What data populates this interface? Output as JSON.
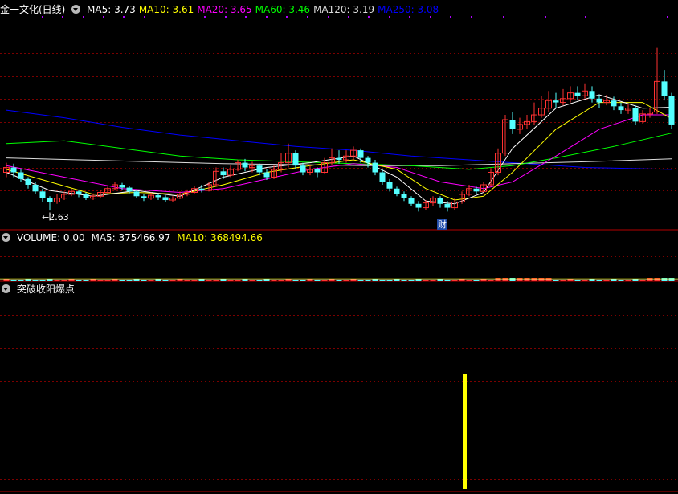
{
  "main_panel": {
    "title": "金一文化(日线)",
    "indicators": [
      {
        "label": "MA5: 3.73",
        "color": "#ffffff"
      },
      {
        "label": "MA10: 3.61",
        "color": "#ffff00"
      },
      {
        "label": "MA20: 3.65",
        "color": "#ff00ff"
      },
      {
        "label": "MA60: 3.46",
        "color": "#00ff00"
      },
      {
        "label": "MA120: 3.19",
        "color": "#dcdcdc"
      },
      {
        "label": "MA250: 3.08",
        "color": "#0000ff"
      }
    ],
    "low_label": "←2.63",
    "event_marker": "财"
  },
  "volume_panel": {
    "title": "VOLUME: 0.00",
    "ma5": "MA5: 375466.97",
    "ma10": "MA10: 368494.66"
  },
  "signal_panel": {
    "title": "突破收阳爆点"
  },
  "colors": {
    "up": "#ff3232",
    "down": "#54ffff",
    "grid": "#7a0000",
    "ma5": "#ffffff",
    "ma10": "#ffff00",
    "ma20": "#ff00ff",
    "ma60": "#00ff00",
    "ma120": "#dcdcdc",
    "ma250": "#0000ff",
    "signal": "#ffff00"
  },
  "chart_data": {
    "type": "candlestick",
    "symbol": "金一文化",
    "period": "日线",
    "ylim": [
      2.5,
      4.7
    ],
    "low_marker": 2.63,
    "ma_last": {
      "MA5": 3.73,
      "MA10": 3.61,
      "MA20": 3.65,
      "MA60": 3.46,
      "MA120": 3.19,
      "MA250": 3.08
    },
    "candles": [
      [
        3.05,
        3.1,
        3.15,
        3.0
      ],
      [
        3.1,
        3.05,
        3.14,
        3.0
      ],
      [
        3.05,
        2.98,
        3.08,
        2.95
      ],
      [
        2.98,
        2.92,
        3.0,
        2.88
      ],
      [
        2.92,
        2.85,
        2.95,
        2.82
      ],
      [
        2.85,
        2.78,
        2.88,
        2.74
      ],
      [
        2.78,
        2.74,
        2.8,
        2.65
      ],
      [
        2.74,
        2.78,
        2.82,
        2.72
      ],
      [
        2.78,
        2.82,
        2.85,
        2.76
      ],
      [
        2.82,
        2.85,
        2.88,
        2.8
      ],
      [
        2.85,
        2.82,
        2.87,
        2.79
      ],
      [
        2.82,
        2.78,
        2.84,
        2.76
      ],
      [
        2.78,
        2.8,
        2.83,
        2.76
      ],
      [
        2.8,
        2.84,
        2.86,
        2.78
      ],
      [
        2.84,
        2.88,
        2.9,
        2.82
      ],
      [
        2.88,
        2.92,
        2.95,
        2.86
      ],
      [
        2.92,
        2.89,
        2.94,
        2.86
      ],
      [
        2.89,
        2.85,
        2.91,
        2.83
      ],
      [
        2.85,
        2.8,
        2.87,
        2.78
      ],
      [
        2.8,
        2.78,
        2.82,
        2.75
      ],
      [
        2.78,
        2.81,
        2.84,
        2.76
      ],
      [
        2.81,
        2.79,
        2.83,
        2.76
      ],
      [
        2.79,
        2.76,
        2.81,
        2.74
      ],
      [
        2.76,
        2.78,
        2.8,
        2.74
      ],
      [
        2.78,
        2.82,
        2.85,
        2.77
      ],
      [
        2.82,
        2.84,
        2.87,
        2.8
      ],
      [
        2.84,
        2.88,
        2.91,
        2.83
      ],
      [
        2.88,
        2.86,
        2.92,
        2.84
      ],
      [
        2.86,
        2.92,
        2.95,
        2.85
      ],
      [
        2.92,
        3.06,
        3.1,
        2.9
      ],
      [
        3.06,
        3.02,
        3.1,
        2.98
      ],
      [
        3.02,
        3.08,
        3.12,
        3.0
      ],
      [
        3.08,
        3.15,
        3.18,
        3.06
      ],
      [
        3.15,
        3.1,
        3.19,
        3.06
      ],
      [
        3.1,
        3.12,
        3.16,
        3.05
      ],
      [
        3.12,
        3.05,
        3.14,
        3.02
      ],
      [
        3.05,
        3.0,
        3.08,
        2.97
      ],
      [
        3.0,
        3.08,
        3.12,
        2.98
      ],
      [
        3.08,
        3.15,
        3.25,
        3.05
      ],
      [
        3.15,
        3.25,
        3.35,
        3.1
      ],
      [
        3.25,
        3.12,
        3.28,
        3.08
      ],
      [
        3.12,
        3.05,
        3.15,
        3.02
      ],
      [
        3.05,
        3.08,
        3.12,
        3.02
      ],
      [
        3.08,
        3.05,
        3.1,
        3.0
      ],
      [
        3.05,
        3.15,
        3.2,
        3.04
      ],
      [
        3.15,
        3.2,
        3.3,
        3.12
      ],
      [
        3.2,
        3.18,
        3.28,
        3.14
      ],
      [
        3.18,
        3.22,
        3.28,
        3.15
      ],
      [
        3.22,
        3.28,
        3.32,
        3.18
      ],
      [
        3.28,
        3.2,
        3.3,
        3.15
      ],
      [
        3.2,
        3.15,
        3.22,
        3.1
      ],
      [
        3.15,
        3.05,
        3.18,
        3.02
      ],
      [
        3.05,
        2.95,
        3.08,
        2.92
      ],
      [
        2.95,
        2.88,
        2.98,
        2.85
      ],
      [
        2.88,
        2.82,
        2.9,
        2.8
      ],
      [
        2.82,
        2.78,
        2.85,
        2.75
      ],
      [
        2.78,
        2.72,
        2.8,
        2.7
      ],
      [
        2.72,
        2.68,
        2.75,
        2.64
      ],
      [
        2.68,
        2.73,
        2.76,
        2.66
      ],
      [
        2.73,
        2.78,
        2.8,
        2.7
      ],
      [
        2.78,
        2.72,
        2.8,
        2.68
      ],
      [
        2.72,
        2.68,
        2.75,
        2.64
      ],
      [
        2.68,
        2.74,
        2.78,
        2.66
      ],
      [
        2.74,
        2.82,
        2.85,
        2.72
      ],
      [
        2.82,
        2.88,
        2.92,
        2.8
      ],
      [
        2.88,
        2.85,
        2.9,
        2.82
      ],
      [
        2.85,
        2.92,
        2.95,
        2.84
      ],
      [
        2.92,
        3.05,
        3.08,
        2.9
      ],
      [
        3.05,
        3.25,
        3.3,
        3.02
      ],
      [
        3.25,
        3.6,
        3.65,
        3.22
      ],
      [
        3.6,
        3.5,
        3.68,
        3.45
      ],
      [
        3.5,
        3.55,
        3.62,
        3.45
      ],
      [
        3.55,
        3.58,
        3.65,
        3.5
      ],
      [
        3.58,
        3.65,
        3.78,
        3.55
      ],
      [
        3.65,
        3.72,
        3.85,
        3.62
      ],
      [
        3.72,
        3.8,
        3.9,
        3.68
      ],
      [
        3.8,
        3.78,
        3.88,
        3.72
      ],
      [
        3.78,
        3.82,
        3.92,
        3.75
      ],
      [
        3.82,
        3.88,
        3.95,
        3.78
      ],
      [
        3.88,
        3.85,
        3.95,
        3.8
      ],
      [
        3.85,
        3.9,
        3.98,
        3.82
      ],
      [
        3.9,
        3.82,
        3.95,
        3.78
      ],
      [
        3.82,
        3.78,
        3.86,
        3.72
      ],
      [
        3.78,
        3.8,
        3.86,
        3.75
      ],
      [
        3.8,
        3.74,
        3.84,
        3.7
      ],
      [
        3.74,
        3.7,
        3.78,
        3.66
      ],
      [
        3.7,
        3.72,
        3.76,
        3.66
      ],
      [
        3.72,
        3.58,
        3.75,
        3.55
      ],
      [
        3.58,
        3.66,
        3.7,
        3.56
      ],
      [
        3.66,
        3.68,
        3.72,
        3.62
      ],
      [
        3.68,
        4.0,
        4.35,
        3.66
      ],
      [
        4.0,
        3.85,
        4.12,
        3.8
      ],
      [
        3.85,
        3.55,
        3.88,
        3.5
      ]
    ],
    "ma_series": {
      "MA5": [
        [
          0,
          3.05
        ],
        [
          6,
          2.86
        ],
        [
          12,
          2.8
        ],
        [
          18,
          2.86
        ],
        [
          24,
          2.8
        ],
        [
          30,
          3.0
        ],
        [
          36,
          3.1
        ],
        [
          42,
          3.15
        ],
        [
          48,
          3.22
        ],
        [
          54,
          3.0
        ],
        [
          58,
          2.75
        ],
        [
          62,
          2.72
        ],
        [
          66,
          2.84
        ],
        [
          70,
          3.3
        ],
        [
          76,
          3.72
        ],
        [
          82,
          3.86
        ],
        [
          88,
          3.72
        ],
        [
          92,
          3.73
        ]
      ],
      "MA10": [
        [
          0,
          3.08
        ],
        [
          6,
          2.95
        ],
        [
          12,
          2.82
        ],
        [
          18,
          2.84
        ],
        [
          24,
          2.82
        ],
        [
          30,
          2.92
        ],
        [
          36,
          3.05
        ],
        [
          42,
          3.12
        ],
        [
          48,
          3.18
        ],
        [
          54,
          3.08
        ],
        [
          58,
          2.88
        ],
        [
          62,
          2.76
        ],
        [
          66,
          2.8
        ],
        [
          70,
          3.05
        ],
        [
          76,
          3.5
        ],
        [
          82,
          3.78
        ],
        [
          88,
          3.78
        ],
        [
          92,
          3.61
        ]
      ],
      "MA20": [
        [
          0,
          3.12
        ],
        [
          8,
          3.0
        ],
        [
          16,
          2.88
        ],
        [
          24,
          2.84
        ],
        [
          30,
          2.88
        ],
        [
          36,
          2.98
        ],
        [
          42,
          3.08
        ],
        [
          48,
          3.14
        ],
        [
          54,
          3.1
        ],
        [
          60,
          2.95
        ],
        [
          66,
          2.88
        ],
        [
          70,
          2.95
        ],
        [
          76,
          3.22
        ],
        [
          82,
          3.5
        ],
        [
          88,
          3.65
        ],
        [
          92,
          3.65
        ]
      ],
      "MA60": [
        [
          0,
          3.35
        ],
        [
          8,
          3.38
        ],
        [
          16,
          3.3
        ],
        [
          24,
          3.22
        ],
        [
          32,
          3.18
        ],
        [
          40,
          3.16
        ],
        [
          48,
          3.14
        ],
        [
          56,
          3.12
        ],
        [
          64,
          3.08
        ],
        [
          70,
          3.12
        ],
        [
          76,
          3.2
        ],
        [
          84,
          3.32
        ],
        [
          92,
          3.46
        ]
      ],
      "MA120": [
        [
          0,
          3.2
        ],
        [
          10,
          3.18
        ],
        [
          20,
          3.16
        ],
        [
          30,
          3.14
        ],
        [
          40,
          3.13
        ],
        [
          50,
          3.12
        ],
        [
          60,
          3.12
        ],
        [
          70,
          3.14
        ],
        [
          80,
          3.16
        ],
        [
          92,
          3.19
        ]
      ],
      "MA250": [
        [
          0,
          3.7
        ],
        [
          8,
          3.62
        ],
        [
          16,
          3.52
        ],
        [
          24,
          3.44
        ],
        [
          32,
          3.38
        ],
        [
          40,
          3.32
        ],
        [
          48,
          3.28
        ],
        [
          56,
          3.22
        ],
        [
          64,
          3.18
        ],
        [
          72,
          3.14
        ],
        [
          80,
          3.1
        ],
        [
          92,
          3.08
        ]
      ]
    },
    "volume": {
      "ma5": 375466.97,
      "ma10": 368494.66
    },
    "signal": {
      "type": "bar",
      "index": 66,
      "value": 1
    }
  }
}
